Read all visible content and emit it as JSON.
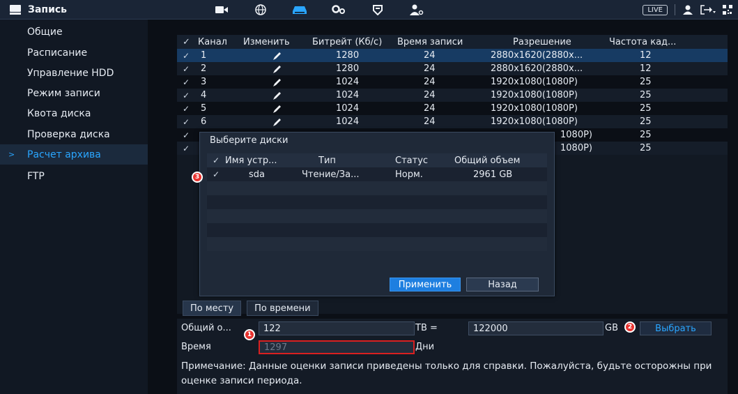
{
  "header": {
    "title": "Запись",
    "live_label": "LIVE"
  },
  "sidebar": {
    "items": [
      {
        "label": "Общие"
      },
      {
        "label": "Расписание"
      },
      {
        "label": "Управление HDD"
      },
      {
        "label": "Режим записи"
      },
      {
        "label": "Квота диска"
      },
      {
        "label": "Проверка диска"
      },
      {
        "label": "Расчет архива",
        "active": true
      },
      {
        "label": "FTP"
      }
    ]
  },
  "table": {
    "columns": [
      "Канал",
      "Изменить",
      "Битрейт (Кб/с)",
      "Время записи",
      "Разрешение",
      "Частота кад..."
    ],
    "rows": [
      {
        "ch": "1",
        "bitrate": "1280",
        "time": "24",
        "res": "2880x1620(2880x...",
        "fps": "12"
      },
      {
        "ch": "2",
        "bitrate": "1280",
        "time": "24",
        "res": "2880x1620(2880x...",
        "fps": "12"
      },
      {
        "ch": "3",
        "bitrate": "1024",
        "time": "24",
        "res": "1920x1080(1080P)",
        "fps": "25"
      },
      {
        "ch": "4",
        "bitrate": "1024",
        "time": "24",
        "res": "1920x1080(1080P)",
        "fps": "25"
      },
      {
        "ch": "5",
        "bitrate": "1024",
        "time": "24",
        "res": "1920x1080(1080P)",
        "fps": "25"
      },
      {
        "ch": "6",
        "bitrate": "1024",
        "time": "24",
        "res": "1920x1080(1080P)",
        "fps": "25"
      },
      {
        "ch": "",
        "bitrate": "",
        "time": "",
        "res": "1080P)",
        "fps": "25"
      },
      {
        "ch": "",
        "bitrate": "",
        "time": "",
        "res": "1080P)",
        "fps": "25"
      }
    ]
  },
  "dialog": {
    "title": "Выберите диски",
    "columns": [
      "Имя устр...",
      "Тип",
      "Статус",
      "Общий объем"
    ],
    "rows": [
      {
        "name": "sda",
        "type": "Чтение/За...",
        "status": "Норм.",
        "total": "2961 GB"
      }
    ],
    "apply_label": "Применить",
    "back_label": "Назад"
  },
  "tabs": {
    "by_place": "По месту",
    "by_time": "По времени"
  },
  "calc": {
    "total_label": "Общий о...",
    "total_value": "122",
    "tb_label": "TB =",
    "gb_value": "122000",
    "gb_label": "GB",
    "select_label": "Выбрать",
    "time_label": "Время",
    "time_value": "1297",
    "days_label": "Дни",
    "note": "Примечание: Данные оценки записи приведены только для справки. Пожалуйста, будьте осторожны при оценке записи периода."
  },
  "markers": [
    "1",
    "2",
    "3"
  ],
  "colors": {
    "accent": "#2aa6ff",
    "marker": "#e8332f",
    "selected_row": "#173b63"
  }
}
